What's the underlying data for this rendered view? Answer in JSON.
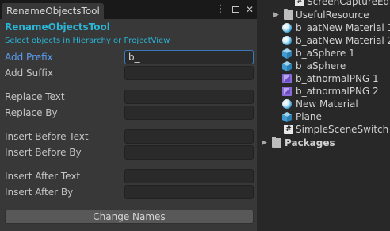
{
  "window": {
    "tab_title": "RenameObjectsTool",
    "menu_icon": "kebab-icon",
    "maximize_icon": "maximize-icon",
    "close_icon": "close-icon",
    "close_glyph": "✕",
    "kebab_glyph": "⋮"
  },
  "tool": {
    "title": "RenameObjectsTool",
    "subtitle": "Select objects in Hierarchy or ProjectView",
    "fields": {
      "add_prefix": {
        "label": "Add Prefix",
        "value": "b_"
      },
      "add_suffix": {
        "label": "Add Suffix",
        "value": ""
      },
      "replace_text": {
        "label": "Replace Text",
        "value": ""
      },
      "replace_by": {
        "label": "Replace By",
        "value": ""
      },
      "insert_before_text": {
        "label": "Insert Before Text",
        "value": ""
      },
      "insert_before_by": {
        "label": "Insert Before By",
        "value": ""
      },
      "insert_after_text": {
        "label": "Insert After Text",
        "value": ""
      },
      "insert_after_by": {
        "label": "Insert After By",
        "value": ""
      }
    },
    "button_label": "Change Names"
  },
  "colors": {
    "accent": "#2bb5d6",
    "active_label": "#5c9cf0",
    "focus_border": "#3a79bb"
  },
  "project": {
    "items": [
      {
        "label": "ScreenCaptureEdit",
        "icon": "script-icon"
      },
      {
        "label": "UsefulResource",
        "icon": "folder-icon"
      },
      {
        "label": "b_aatNew Material 1",
        "icon": "material-icon"
      },
      {
        "label": "b_aatNew Material 2",
        "icon": "material-icon"
      },
      {
        "label": "b_aSphere 1",
        "icon": "mesh-icon"
      },
      {
        "label": "b_aSphere",
        "icon": "mesh-icon"
      },
      {
        "label": "b_atnormalPNG 1",
        "icon": "texture-icon"
      },
      {
        "label": "b_atnormalPNG 2",
        "icon": "texture-icon"
      },
      {
        "label": "New Material",
        "icon": "material-icon"
      },
      {
        "label": "Plane",
        "icon": "mesh-icon"
      },
      {
        "label": "SimpleSceneSwitch",
        "icon": "script-icon"
      },
      {
        "label": "Packages",
        "icon": "folder-icon"
      }
    ]
  }
}
